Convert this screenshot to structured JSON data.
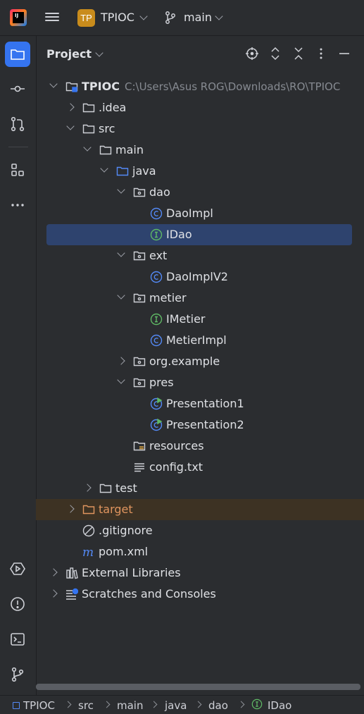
{
  "header": {
    "app_logo_text": "IJ",
    "project_badge": "TP",
    "project_name": "TPIOC",
    "branch": "main"
  },
  "panel": {
    "title": "Project"
  },
  "tree": [
    {
      "label": "TPIOC",
      "path": "C:\\Users\\Asus ROG\\Downloads\\RO\\TPIOC",
      "icon": "module-folder-icon",
      "arrow": "down",
      "level": 0
    },
    {
      "label": ".idea",
      "icon": "folder-icon",
      "arrow": "right",
      "level": 1
    },
    {
      "label": "src",
      "icon": "folder-icon",
      "arrow": "down",
      "level": 1
    },
    {
      "label": "main",
      "icon": "folder-icon",
      "arrow": "down",
      "level": 2
    },
    {
      "label": "java",
      "icon": "source-folder-icon",
      "arrow": "down",
      "level": 3
    },
    {
      "label": "dao",
      "icon": "package-icon",
      "arrow": "down",
      "level": 4
    },
    {
      "label": "DaoImpl",
      "icon": "class-icon",
      "level": 5
    },
    {
      "label": "IDao",
      "icon": "interface-icon",
      "level": 5,
      "selected": true
    },
    {
      "label": "ext",
      "icon": "package-icon",
      "arrow": "down",
      "level": 4
    },
    {
      "label": "DaoImplV2",
      "icon": "class-icon",
      "level": 5
    },
    {
      "label": "metier",
      "icon": "package-icon",
      "arrow": "down",
      "level": 4
    },
    {
      "label": "IMetier",
      "icon": "interface-icon",
      "level": 5
    },
    {
      "label": "MetierImpl",
      "icon": "class-icon",
      "level": 5
    },
    {
      "label": "org.example",
      "icon": "package-icon",
      "arrow": "right",
      "level": 4
    },
    {
      "label": "pres",
      "icon": "package-icon",
      "arrow": "down",
      "level": 4
    },
    {
      "label": "Presentation1",
      "icon": "runnable-class-icon",
      "level": 5
    },
    {
      "label": "Presentation2",
      "icon": "runnable-class-icon",
      "level": 5
    },
    {
      "label": "resources",
      "icon": "resources-folder-icon",
      "level": 4
    },
    {
      "label": "config.txt",
      "icon": "text-file-icon",
      "level": 4
    },
    {
      "label": "test",
      "icon": "folder-icon",
      "arrow": "right",
      "level": 2
    },
    {
      "label": "target",
      "icon": "excluded-folder-icon",
      "arrow": "right",
      "level": 1,
      "excluded": true
    },
    {
      "label": ".gitignore",
      "icon": "gitignore-icon",
      "level": 1
    },
    {
      "label": "pom.xml",
      "icon": "maven-icon",
      "level": 1
    },
    {
      "label": "External Libraries",
      "icon": "libraries-icon",
      "arrow": "right",
      "level": 0
    },
    {
      "label": "Scratches and Consoles",
      "icon": "scratches-icon",
      "arrow": "right",
      "level": 0
    }
  ],
  "statusbar": {
    "breadcrumbs": [
      "TPIOC",
      "src",
      "main",
      "java",
      "dao",
      "IDao"
    ]
  },
  "colors": {
    "accent": "#3574f0",
    "selection": "#2e436e",
    "excluded_text": "#e0955f",
    "project_badge": "#c98c1c"
  }
}
